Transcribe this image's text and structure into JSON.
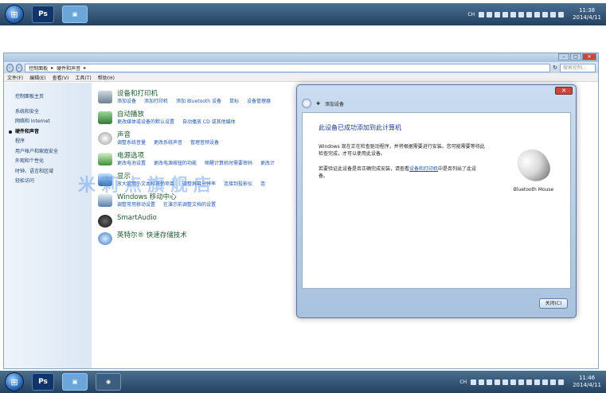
{
  "taskbar_top": {
    "lang": "CH",
    "time": "11:38",
    "date": "2014/4/11",
    "ps_label": "Ps"
  },
  "taskbar_bottom": {
    "lang": "CH",
    "time": "11:46",
    "date": "2014/4/11",
    "ps_label": "Ps"
  },
  "window": {
    "breadcrumb": [
      "控制面板",
      "硬件和声音"
    ],
    "search_placeholder": "搜索控制...",
    "menu": [
      "文件(F)",
      "编辑(E)",
      "查看(V)",
      "工具(T)",
      "帮助(H)"
    ],
    "sidebar": [
      "控制面板主页",
      "系统和安全",
      "网络和 Internet",
      "硬件和声音",
      "程序",
      "用户帐户和家庭安全",
      "外观和个性化",
      "时钟、语言和区域",
      "轻松访问"
    ],
    "categories": [
      {
        "title": "设备和打印机",
        "links": [
          "添加设备",
          "添加打印机",
          "添加 Bluetooth 设备",
          "鼠标",
          "设备管理器"
        ]
      },
      {
        "title": "自动播放",
        "links": [
          "更改媒体或设备的默认设置",
          "自动播放 CD 或其他媒体"
        ]
      },
      {
        "title": "声音",
        "links": [
          "调整系统音量",
          "更改系统声音",
          "管理音频设备"
        ]
      },
      {
        "title": "电源选项",
        "links": [
          "更改电池设置",
          "更改电源按钮的功能",
          "唤醒计算机时需要密码",
          "更改计"
        ]
      },
      {
        "title": "显示",
        "links": [
          "放大或缩小文本和其他项目",
          "调整屏幕分辨率",
          "连接到投影仪",
          "连"
        ]
      },
      {
        "title": "Windows 移动中心",
        "links": [
          "调整常用移动设置",
          "在演示前调整文档的设置"
        ]
      },
      {
        "title": "SmartAudio",
        "links": []
      },
      {
        "title": "英特尔® 快速存储技术",
        "links": []
      }
    ]
  },
  "watermark": "米莉点旗舰店",
  "dialog": {
    "header": "添加设备",
    "title": "此设备已成功添加到此计算机",
    "p1": "Windows 现在正在检查驱动程序，并将根据需要进行安装。您可能需要等待此检查完成，才可以使用此设备。",
    "p2_a": "若要验证此设备是否正确完成安装，请查看",
    "p2_link": "设备和打印机",
    "p2_b": "中是否列出了此设备。",
    "device_label": "Bluetooth Mouse",
    "close_label": "关闭(C)"
  }
}
